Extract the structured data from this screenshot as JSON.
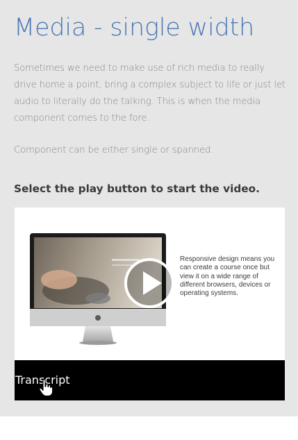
{
  "page": {
    "title": "Media - single width",
    "paragraphs": [
      "Sometimes we need to make use of rich media to really drive home a point, bring a complex subject to life or just let audio to literally do the talking. This is when the media component comes to the fore.",
      "Component can be either single or spanned."
    ],
    "instruction": "Select the play button to start the video."
  },
  "media": {
    "video_text": "Responsive design means you can create a course once but view it on a wide range of different browsers, devices or operating systems.",
    "play_icon": "play-icon",
    "transcript_label": "Transcript"
  },
  "colors": {
    "title": "#4c78b4",
    "body_text": "#858585",
    "panel_background": "#e6e6e6",
    "transcript_bar": "#000000"
  }
}
